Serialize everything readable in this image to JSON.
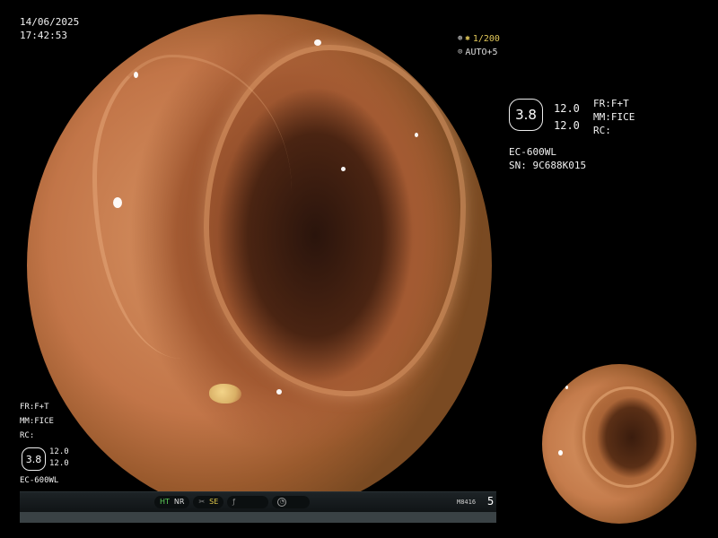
{
  "datetime": {
    "date": "14/06/2025",
    "time": "17:42:53"
  },
  "shutter": {
    "value": "1/200",
    "auto_label": "AUTO+5",
    "icon": "shutter-icon",
    "auto_icon": "iris-icon"
  },
  "right_info": {
    "badge": "3.8",
    "val1": "12.0",
    "val2": "12.0",
    "fr": "FR:F+T",
    "mm": "MM:FICE",
    "rc": "RC:",
    "model": "EC-600WL",
    "serial": "SN: 9C688K015"
  },
  "left_info": {
    "fr": "FR:F+T",
    "mm": "MM:FICE",
    "rc": "RC:",
    "badge": "3.8",
    "val1": "12.0",
    "val2": "12.0",
    "model": "EC-600WL"
  },
  "status_bar": {
    "ht": "HT",
    "nr": "NR",
    "se": "SE",
    "mode_code": "M8416",
    "mode_num": "5"
  },
  "colors": {
    "status_green": "#5fd35a",
    "status_yellow": "#e2c94a",
    "background": "#000000"
  }
}
